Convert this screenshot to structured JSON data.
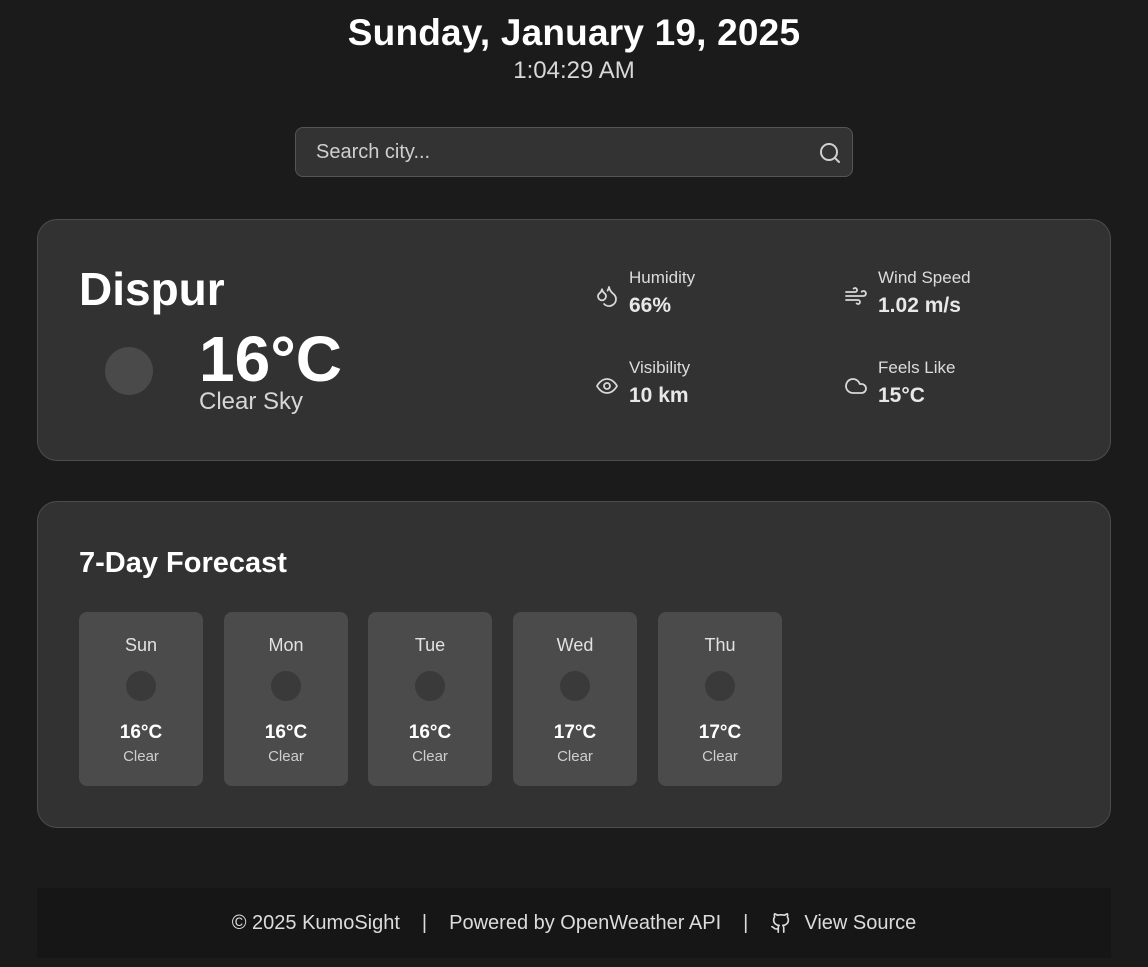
{
  "header": {
    "date": "Sunday, January 19, 2025",
    "time": "1:04:29 AM"
  },
  "search": {
    "placeholder": "Search city...",
    "value": "",
    "icon": "search-icon"
  },
  "current": {
    "city": "Dispur",
    "temperature": "16°C",
    "condition": "Clear Sky",
    "icon": "weather-icon",
    "stats": {
      "humidity": {
        "label": "Humidity",
        "value": "66%",
        "icon": "droplets-icon"
      },
      "wind": {
        "label": "Wind Speed",
        "value": "1.02 m/s",
        "icon": "wind-icon"
      },
      "visibility": {
        "label": "Visibility",
        "value": "10 km",
        "icon": "eye-icon"
      },
      "feels_like": {
        "label": "Feels Like",
        "value": "15°C",
        "icon": "cloud-icon"
      }
    }
  },
  "forecast": {
    "title": "7-Day Forecast",
    "days": [
      {
        "day": "Sun",
        "temp": "16°C",
        "condition": "Clear"
      },
      {
        "day": "Mon",
        "temp": "16°C",
        "condition": "Clear"
      },
      {
        "day": "Tue",
        "temp": "16°C",
        "condition": "Clear"
      },
      {
        "day": "Wed",
        "temp": "17°C",
        "condition": "Clear"
      },
      {
        "day": "Thu",
        "temp": "17°C",
        "condition": "Clear"
      }
    ]
  },
  "footer": {
    "copyright": "© 2025 KumoSight",
    "separator": "|",
    "powered_by": "Powered by OpenWeather API",
    "source_label": "View Source",
    "source_icon": "github-icon"
  },
  "colors": {
    "background": "#1b1b1b",
    "card": "#323232",
    "day_card": "#4b4b4b",
    "footer": "#161616",
    "text": "#ffffff"
  }
}
